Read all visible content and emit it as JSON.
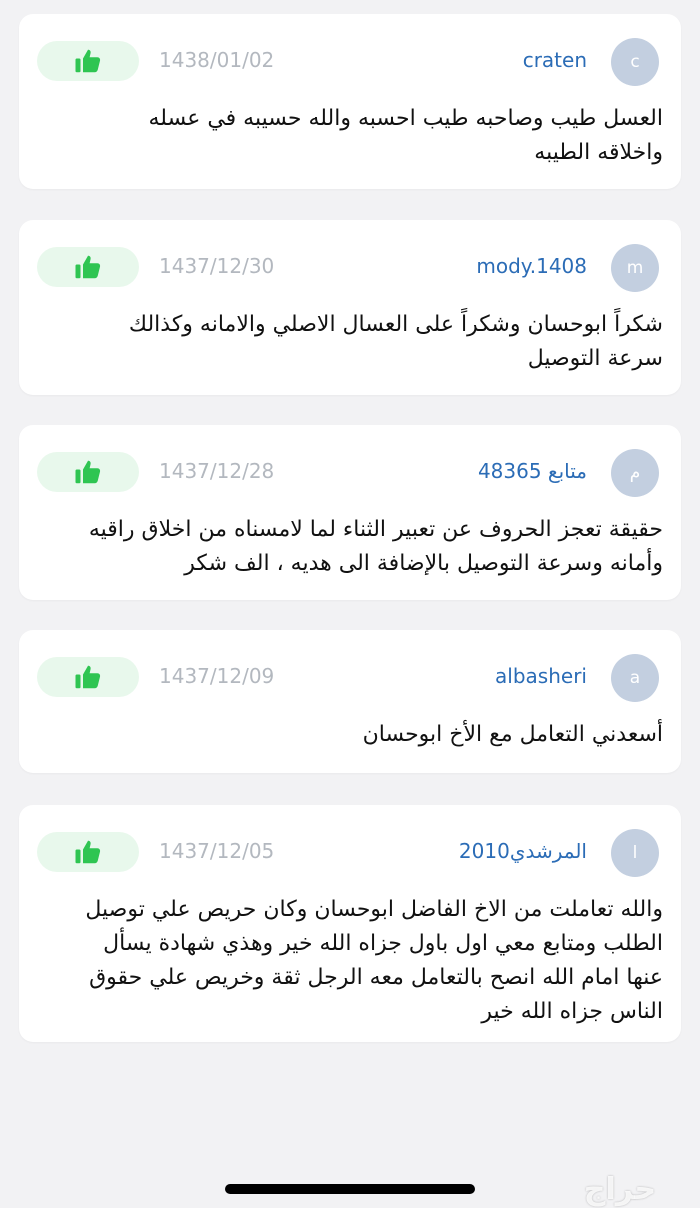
{
  "reviews": [
    {
      "avatar_letter": "c",
      "username": "craten",
      "date": "1438/01/02",
      "text": "العسل طيب وصاحبه طيب احسبه والله حسيبه في  عسله واخلاقه الطيبه"
    },
    {
      "avatar_letter": "m",
      "username": "mody.1408",
      "date": "1437/12/30",
      "text": "شكراً ابوحسان وشكراً على العسال الاصلي والامانه وكذالك سرعة التوصيل"
    },
    {
      "avatar_letter": "م",
      "username": "متابع 48365",
      "date": "1437/12/28",
      "text": "حقيقة تعجز الحروف عن تعبير الثناء لما لامسناه من اخلاق راقيه وأمانه وسرعة التوصيل بالإضافة الى هديه ، الف شكر"
    },
    {
      "avatar_letter": "a",
      "username": "albasheri",
      "date": "1437/12/09",
      "text": "أسعدني التعامل مع الأخ ابوحسان"
    },
    {
      "avatar_letter": "ا",
      "username": "المرشدي2010",
      "date": "1437/12/05",
      "text": "والله تعاملت من الاخ الفاضل ابوحسان وكان حريص علي توصيل الطلب ومتابع معي اول باول جزاه الله خير وهذي شهادة يسأل عنها امام الله انصح بالتعامل معه الرجل ثقة وخريص علي حقوق الناس جزاه الله خير"
    }
  ],
  "like_icon": "thumbs-up-icon",
  "colors": {
    "username": "#2b6cb6",
    "avatar_bg": "#c3cfe0",
    "like_bg": "#e8f8ec",
    "like_icon": "#2fc552",
    "date": "#b3b8bf"
  },
  "watermark": "حراج"
}
